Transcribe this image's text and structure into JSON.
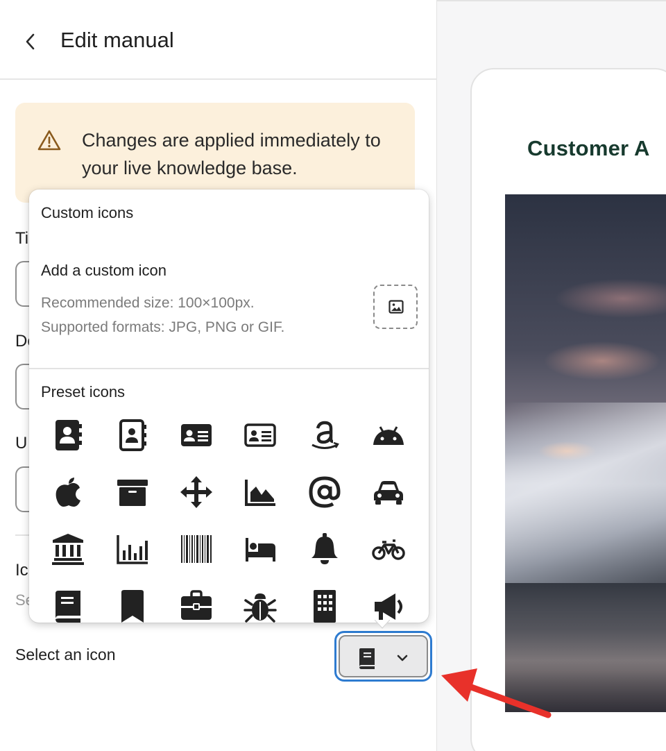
{
  "header": {
    "title": "Edit manual",
    "back_icon": "chevron-left-icon"
  },
  "banner": {
    "icon": "warning-triangle-icon",
    "text": "Changes are applied immediately to your live knowledge base.",
    "bg_color": "#fcf0dc",
    "icon_color": "#8a5a1c"
  },
  "form_fragments": {
    "title_label": "Ti",
    "description_label": "De",
    "url_label": "U",
    "icon_label": "Ic",
    "icon_hint": "Se"
  },
  "icon_picker": {
    "label": "Select an icon",
    "selected_icon": "book-icon",
    "chevron": "chevron-down-icon",
    "focus_color": "#2e7bd0"
  },
  "popover": {
    "custom_heading": "Custom icons",
    "custom_title": "Add a custom icon",
    "custom_desc_line1": "Recommended size: 100×100px.",
    "custom_desc_line2": "Supported formats: JPG, PNG or GIF.",
    "upload_icon": "image-icon",
    "preset_heading": "Preset icons",
    "preset_icons": [
      "address-book-icon",
      "contact-book-icon",
      "id-card-icon",
      "id-card-outline-icon",
      "amazon-icon",
      "android-icon",
      "apple-icon",
      "archive-box-icon",
      "move-arrows-icon",
      "area-chart-icon",
      "at-sign-icon",
      "car-icon",
      "bank-icon",
      "bar-chart-icon",
      "barcode-icon",
      "bed-icon",
      "bell-icon",
      "bicycle-icon",
      "book-icon",
      "bookmark-icon",
      "briefcase-icon",
      "bug-icon",
      "building-icon",
      "megaphone-icon"
    ]
  },
  "preview": {
    "customer_name": "Customer A",
    "brand_color": "#173a2e"
  },
  "annotation": {
    "arrow_color": "#e8312a"
  }
}
